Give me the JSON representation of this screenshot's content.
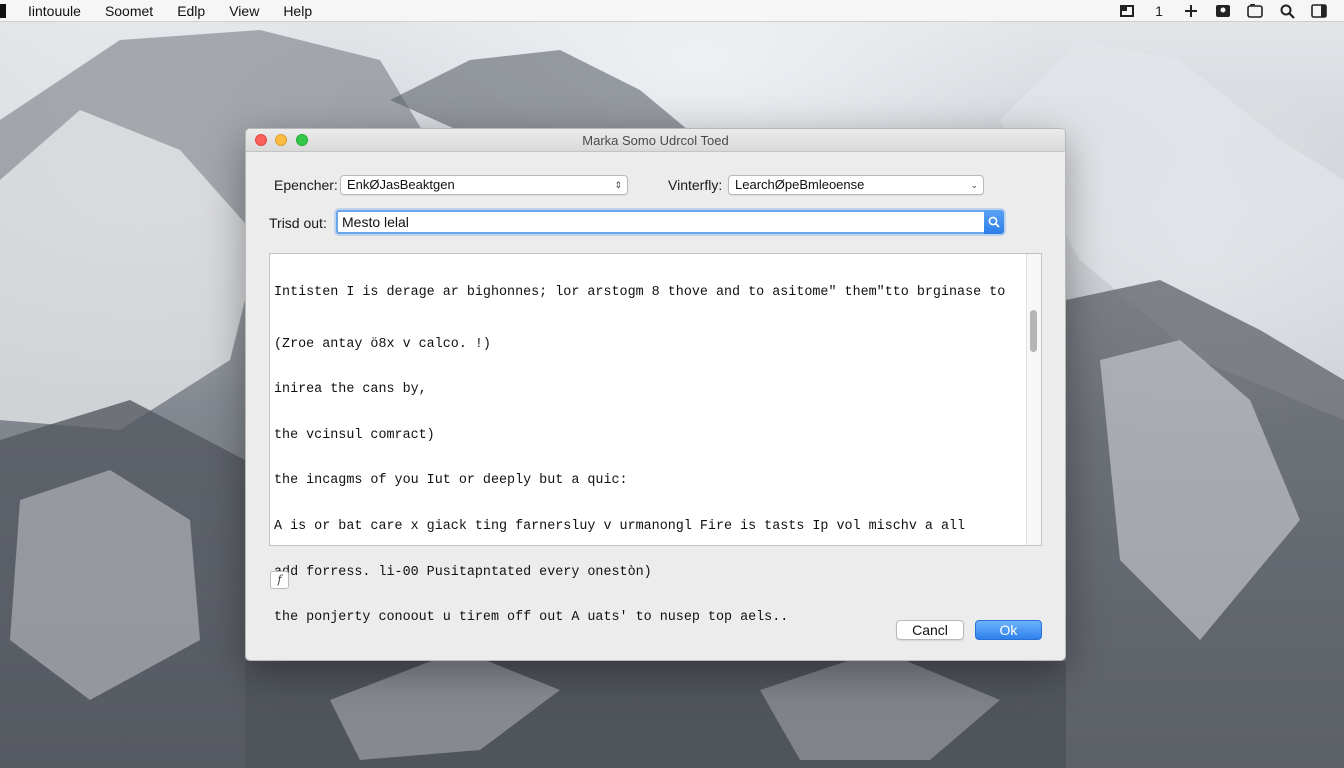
{
  "menubar": {
    "items": [
      "Iintouule",
      "Soomet",
      "Edlp",
      "View",
      "Help"
    ],
    "status_icons": [
      "window-icon",
      "bluetooth-icon",
      "plus-icon",
      "display-icon",
      "screen-icon",
      "search-icon",
      "notification-icon"
    ],
    "status_glyph_1": "1"
  },
  "window": {
    "title": "Marka Somo Udrcol Toed",
    "encoder_label": "Epencher:",
    "encoder_value": "EnkØJasBeaktgen",
    "verify_label": "Vinterfly:",
    "verify_value": "LearchØpeBmleoense",
    "trust_label": "Trisd out:",
    "trust_value": "Mesto lelal",
    "text_lines": [
      "Intisten I is derage ar bighonnes; lor arstogm 8 thove and to asitome\" them\"tto brginase to",
      "(Zroe antay ö8x v calco. !)",
      "inirea the cans by,",
      "the vcinsul comract)",
      "the incagms of you Iut or deeply but a quic:",
      "A is or bat care x giack ting farnersluy v urmanongl Fire is tasts Ip vol mischv a all",
      "add forress. li-00 Pusitapntated every onestòn)",
      "the ponjerty conoout u tirem off out A uats' to nusep top aels.."
    ],
    "small_button_label": "f",
    "cancel_label": "Cancl",
    "ok_label": "Ok"
  },
  "colors": {
    "accent": "#2f80ed",
    "close": "#fc605c",
    "minimize": "#fdbc40",
    "maximize": "#34c84a"
  }
}
